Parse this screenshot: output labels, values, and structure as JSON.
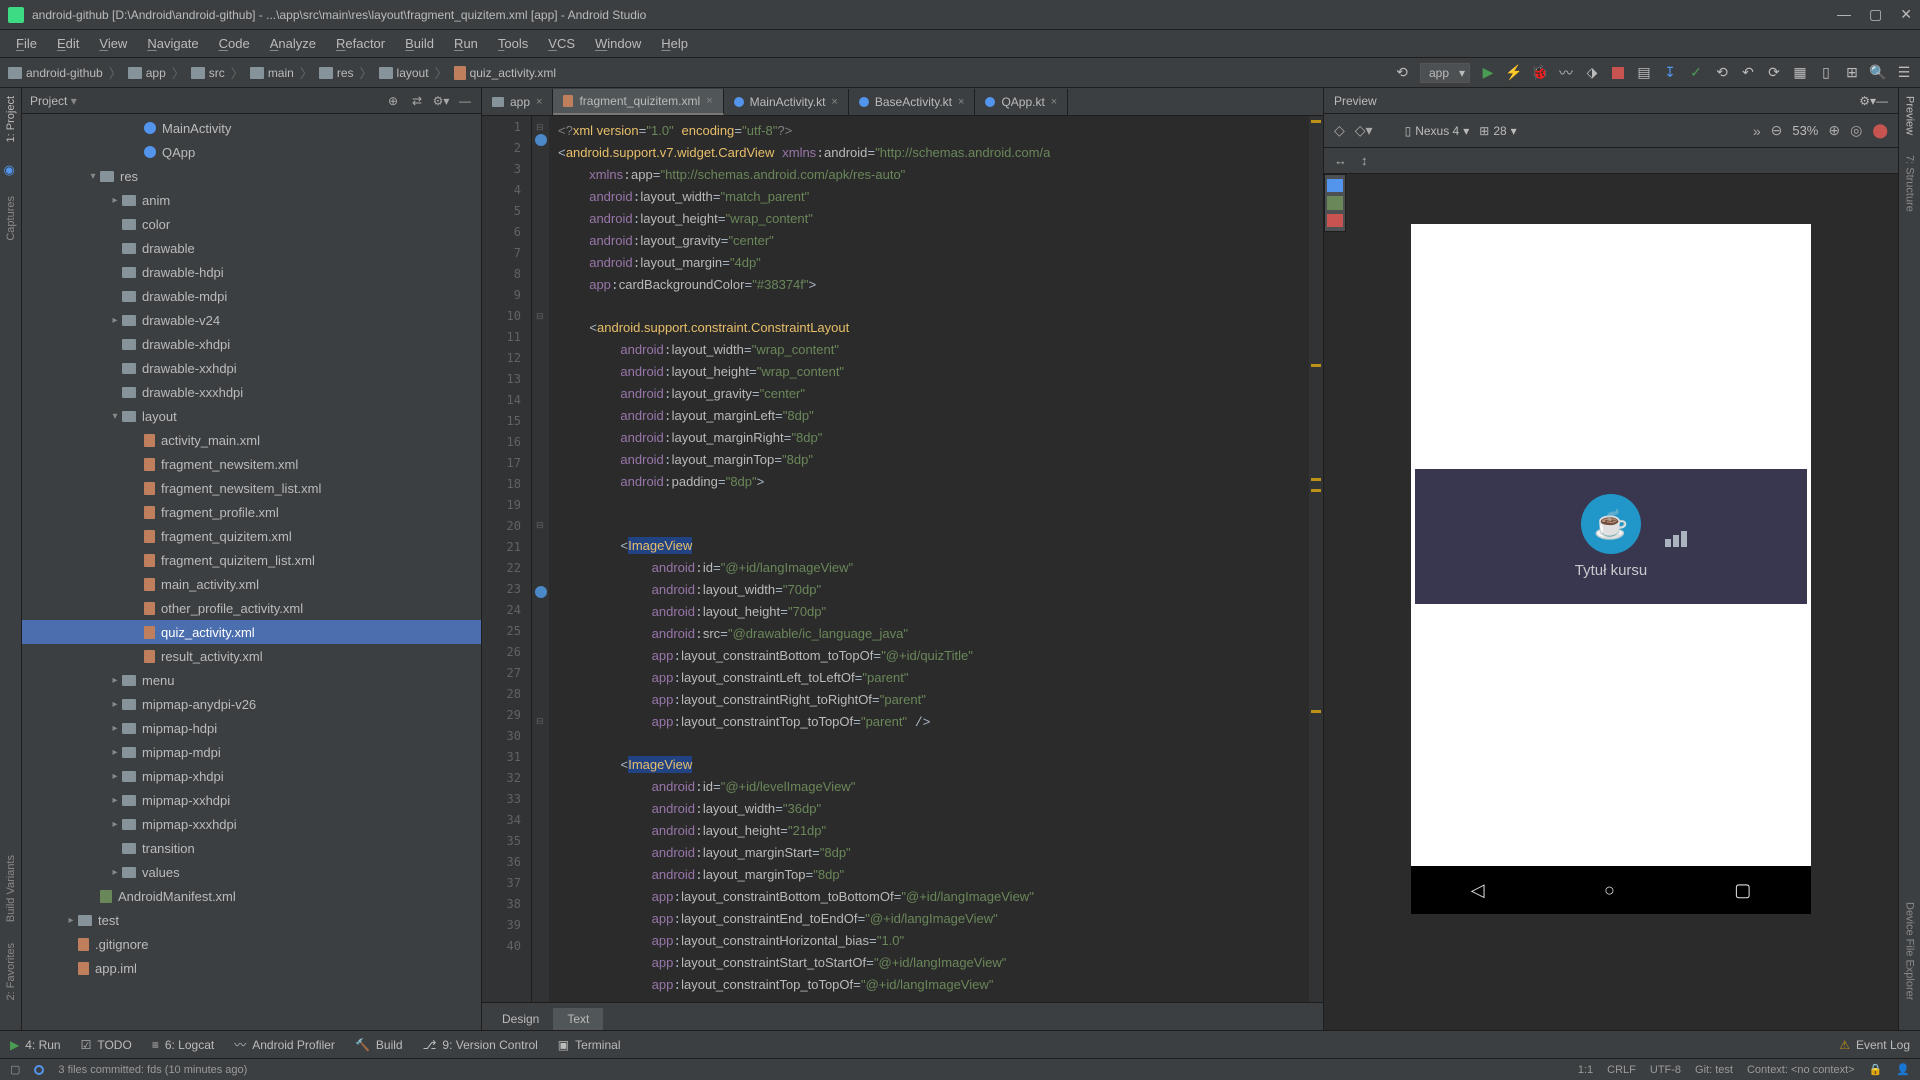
{
  "title": "android-github [D:\\Android\\android-github] - ...\\app\\src\\main\\res\\layout\\fragment_quizitem.xml [app] - Android Studio",
  "menu": [
    "File",
    "Edit",
    "View",
    "Navigate",
    "Code",
    "Analyze",
    "Refactor",
    "Build",
    "Run",
    "Tools",
    "VCS",
    "Window",
    "Help"
  ],
  "breadcrumb": [
    "android-github",
    "app",
    "src",
    "main",
    "res",
    "layout",
    "quiz_activity.xml"
  ],
  "run_config": "app",
  "project_label": "Project",
  "tree": [
    {
      "i": 4,
      "a": "",
      "k": "kt",
      "t": "MainActivity"
    },
    {
      "i": 4,
      "a": "",
      "k": "kt",
      "t": "QApp"
    },
    {
      "i": 2,
      "a": "▾",
      "k": "folder",
      "t": "res"
    },
    {
      "i": 3,
      "a": "▸",
      "k": "folder",
      "t": "anim"
    },
    {
      "i": 3,
      "a": "",
      "k": "folder",
      "t": "color"
    },
    {
      "i": 3,
      "a": "",
      "k": "folder",
      "t": "drawable"
    },
    {
      "i": 3,
      "a": "",
      "k": "folder",
      "t": "drawable-hdpi"
    },
    {
      "i": 3,
      "a": "",
      "k": "folder",
      "t": "drawable-mdpi"
    },
    {
      "i": 3,
      "a": "▸",
      "k": "folder",
      "t": "drawable-v24"
    },
    {
      "i": 3,
      "a": "",
      "k": "folder",
      "t": "drawable-xhdpi"
    },
    {
      "i": 3,
      "a": "",
      "k": "folder",
      "t": "drawable-xxhdpi"
    },
    {
      "i": 3,
      "a": "",
      "k": "folder",
      "t": "drawable-xxxhdpi"
    },
    {
      "i": 3,
      "a": "▾",
      "k": "folder",
      "t": "layout"
    },
    {
      "i": 4,
      "a": "",
      "k": "xml",
      "t": "activity_main.xml"
    },
    {
      "i": 4,
      "a": "",
      "k": "xml",
      "t": "fragment_newsitem.xml"
    },
    {
      "i": 4,
      "a": "",
      "k": "xml",
      "t": "fragment_newsitem_list.xml"
    },
    {
      "i": 4,
      "a": "",
      "k": "xml",
      "t": "fragment_profile.xml"
    },
    {
      "i": 4,
      "a": "",
      "k": "xml",
      "t": "fragment_quizitem.xml"
    },
    {
      "i": 4,
      "a": "",
      "k": "xml",
      "t": "fragment_quizitem_list.xml"
    },
    {
      "i": 4,
      "a": "",
      "k": "xml",
      "t": "main_activity.xml"
    },
    {
      "i": 4,
      "a": "",
      "k": "xml",
      "t": "other_profile_activity.xml"
    },
    {
      "i": 4,
      "a": "",
      "k": "xml",
      "t": "quiz_activity.xml",
      "sel": true
    },
    {
      "i": 4,
      "a": "",
      "k": "xml",
      "t": "result_activity.xml"
    },
    {
      "i": 3,
      "a": "▸",
      "k": "folder",
      "t": "menu"
    },
    {
      "i": 3,
      "a": "▸",
      "k": "folder",
      "t": "mipmap-anydpi-v26"
    },
    {
      "i": 3,
      "a": "▸",
      "k": "folder",
      "t": "mipmap-hdpi"
    },
    {
      "i": 3,
      "a": "▸",
      "k": "folder",
      "t": "mipmap-mdpi"
    },
    {
      "i": 3,
      "a": "▸",
      "k": "folder",
      "t": "mipmap-xhdpi"
    },
    {
      "i": 3,
      "a": "▸",
      "k": "folder",
      "t": "mipmap-xxhdpi"
    },
    {
      "i": 3,
      "a": "▸",
      "k": "folder",
      "t": "mipmap-xxxhdpi"
    },
    {
      "i": 3,
      "a": "",
      "k": "folder",
      "t": "transition"
    },
    {
      "i": 3,
      "a": "▸",
      "k": "folder",
      "t": "values"
    },
    {
      "i": 2,
      "a": "",
      "k": "manifest",
      "t": "AndroidManifest.xml"
    },
    {
      "i": 1,
      "a": "▸",
      "k": "folder",
      "t": "test"
    },
    {
      "i": 1,
      "a": "",
      "k": "xml",
      "t": ".gitignore"
    },
    {
      "i": 1,
      "a": "",
      "k": "xml",
      "t": "app.iml"
    }
  ],
  "tabs": [
    {
      "label": "app",
      "icon": "folder"
    },
    {
      "label": "fragment_quizitem.xml",
      "icon": "xml",
      "active": true
    },
    {
      "label": "MainActivity.kt",
      "icon": "kt"
    },
    {
      "label": "BaseActivity.kt",
      "icon": "kt"
    },
    {
      "label": "QApp.kt",
      "icon": "kt"
    }
  ],
  "preview": {
    "label": "Preview",
    "device": "Nexus 4",
    "api": "28",
    "zoom": "53%",
    "course_title": "Tytuł kursu"
  },
  "dt_tabs": {
    "design": "Design",
    "text": "Text"
  },
  "bottom": {
    "run": "4: Run",
    "todo": "TODO",
    "logcat": "6: Logcat",
    "profiler": "Android Profiler",
    "build": "Build",
    "vcs": "9: Version Control",
    "terminal": "Terminal",
    "eventlog": "Event Log"
  },
  "status": {
    "msg": "3 files committed: fds (10 minutes ago)",
    "pos": "1:1",
    "crlf": "CRLF",
    "enc": "UTF-8",
    "branch": "Git: test",
    "context": "Context: <no context>"
  },
  "left_tabs": {
    "project": "1: Project",
    "captures": "Captures",
    "favorites": "2: Favorites",
    "variants": "Build Variants"
  },
  "right_tabs": {
    "preview": "Preview",
    "structure": "7: Structure",
    "explorer": "Device File Explorer"
  }
}
